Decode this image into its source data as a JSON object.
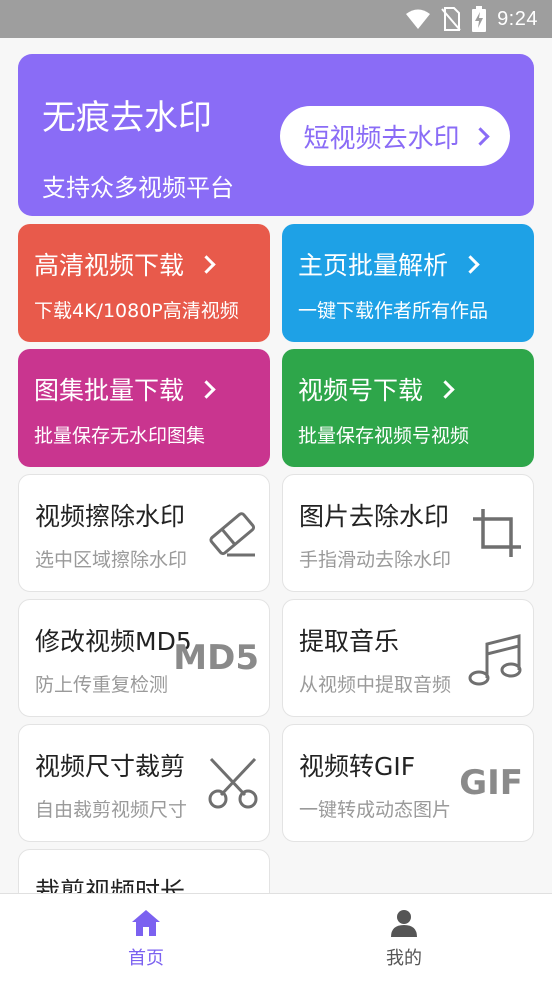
{
  "status_bar": {
    "time": "9:24"
  },
  "hero": {
    "title": "无痕去水印",
    "subtitle": "支持众多视频平台",
    "button_label": "短视频去水印",
    "color": "#8a6cf6"
  },
  "feature_cards": [
    {
      "title": "高清视频下载",
      "subtitle": "下载4K/1080P高清视频",
      "color": "#e85a4b"
    },
    {
      "title": "主页批量解析",
      "subtitle": "一键下载作者所有作品",
      "color": "#1ea1e6"
    },
    {
      "title": "图集批量下载",
      "subtitle": "批量保存无水印图集",
      "color": "#c9358f"
    },
    {
      "title": "视频号下载",
      "subtitle": "批量保存视频号视频",
      "color": "#2ea64a"
    }
  ],
  "tools": [
    {
      "title": "视频擦除水印",
      "subtitle": "选中区域擦除水印",
      "icon": "eraser-icon"
    },
    {
      "title": "图片去除水印",
      "subtitle": "手指滑动去除水印",
      "icon": "crop-icon"
    },
    {
      "title": "修改视频MD5",
      "subtitle": "防上传重复检测",
      "icon": "md5-icon",
      "icon_text": "MD5"
    },
    {
      "title": "提取音乐",
      "subtitle": "从视频中提取音频",
      "icon": "music-note-icon"
    },
    {
      "title": "视频尺寸裁剪",
      "subtitle": "自由裁剪视频尺寸",
      "icon": "scissors-icon"
    },
    {
      "title": "视频转GIF",
      "subtitle": "一键转成动态图片",
      "icon": "gif-icon",
      "icon_text": "GIF"
    },
    {
      "title": "裁剪视频时长",
      "subtitle": "",
      "icon": "clock-icon"
    }
  ],
  "bottom_nav": {
    "items": [
      {
        "label": "首页",
        "icon": "home-icon",
        "active": true
      },
      {
        "label": "我的",
        "icon": "user-icon",
        "active": false
      }
    ],
    "active_color": "#7b61f0",
    "inactive_color": "#555555"
  }
}
